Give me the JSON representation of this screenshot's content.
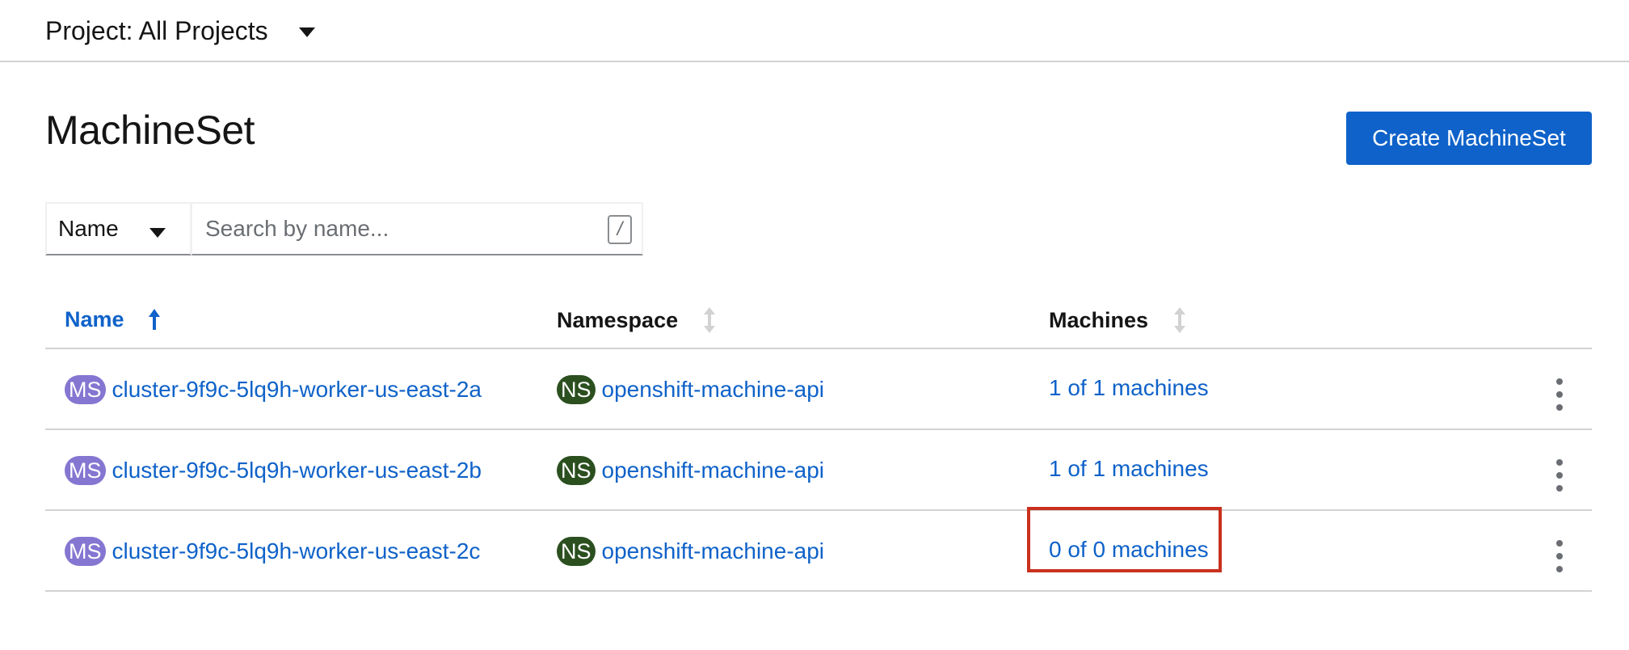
{
  "project": {
    "label": "Project: All Projects"
  },
  "page": {
    "title": "MachineSet",
    "create_button": "Create MachineSet"
  },
  "filter": {
    "type": "Name",
    "placeholder": "Search by name...",
    "shortcut": "/"
  },
  "table": {
    "columns": [
      "Name",
      "Namespace",
      "Machines"
    ],
    "rows": [
      {
        "badge": "MS",
        "name": "cluster-9f9c-5lq9h-worker-us-east-2a",
        "ns_badge": "NS",
        "namespace": "openshift-machine-api",
        "machines": "1 of 1 machines"
      },
      {
        "badge": "MS",
        "name": "cluster-9f9c-5lq9h-worker-us-east-2b",
        "ns_badge": "NS",
        "namespace": "openshift-machine-api",
        "machines": "1 of 1 machines"
      },
      {
        "badge": "MS",
        "name": "cluster-9f9c-5lq9h-worker-us-east-2c",
        "ns_badge": "NS",
        "namespace": "openshift-machine-api",
        "machines": "0 of 0 machines"
      }
    ]
  },
  "colors": {
    "primary": "#0f62c9",
    "ms_badge": "#8476d1",
    "ns_badge": "#2b4f1f",
    "highlight": "#c9311e"
  }
}
